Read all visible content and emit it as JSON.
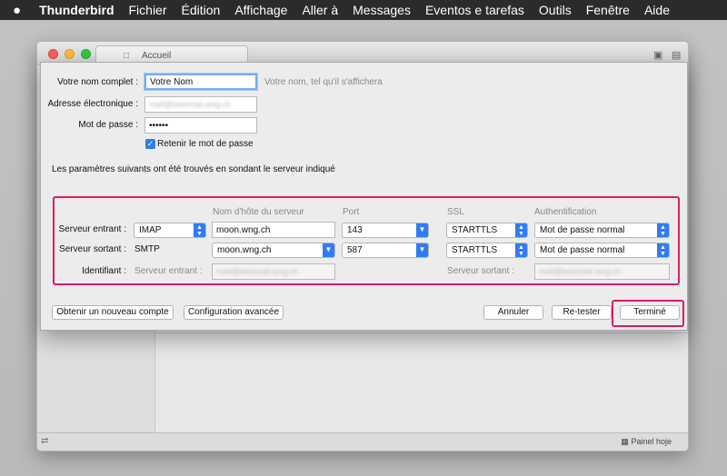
{
  "menubar": {
    "apple": "",
    "items": [
      "Thunderbird",
      "Fichier",
      "Édition",
      "Affichage",
      "Aller à",
      "Messages",
      "Eventos e tarefas",
      "Outils",
      "Fenêtre",
      "Aide"
    ]
  },
  "window": {
    "tab_title": "Accueil",
    "status_right": "Painel hoje"
  },
  "dialog": {
    "name_label": "Votre nom complet :",
    "name_value": "Votre Nom",
    "name_hint": "Votre nom, tel qu'il s'affichera",
    "email_label": "Adresse électronique :",
    "email_value": "mail@bestmail.wng.ch",
    "password_label": "Mot de passe :",
    "password_value": "••••••",
    "remember_label": "Retenir le mot de passe",
    "found_text": "Les paramètres suivants ont été trouvés en sondant le serveur indiqué",
    "columns": {
      "host": "Nom d'hôte du serveur",
      "port": "Port",
      "ssl": "SSL",
      "auth": "Authentification"
    },
    "incoming": {
      "label": "Serveur entrant :",
      "protocol": "IMAP",
      "host": "moon.wng.ch",
      "port": "143",
      "ssl": "STARTTLS",
      "auth": "Mot de passe normal"
    },
    "outgoing": {
      "label": "Serveur sortant :",
      "protocol": "SMTP",
      "host": "moon.wng.ch",
      "port": "587",
      "ssl": "STARTTLS",
      "auth": "Mot de passe normal"
    },
    "identity": {
      "label": "Identifiant :",
      "incoming_label": "Serveur entrant :",
      "incoming_value": "mail@bestmail.wng.ch",
      "outgoing_label": "Serveur sortant :",
      "outgoing_value": "mail@bestmail.wng.ch"
    },
    "buttons": {
      "new_account": "Obtenir un nouveau compte",
      "advanced": "Configuration avancée",
      "cancel": "Annuler",
      "retest": "Re-tester",
      "done": "Terminé"
    }
  },
  "colors": {
    "highlight": "#e0196e",
    "accent": "#2f7cf6"
  }
}
